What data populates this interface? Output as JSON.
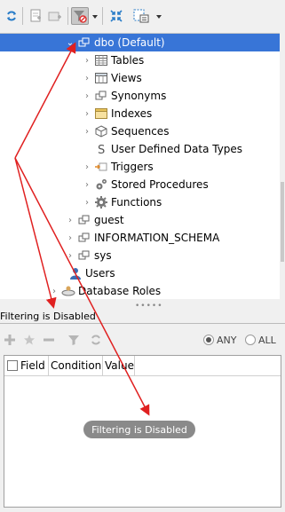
{
  "toolbar": {
    "icons": [
      "refresh-icon",
      "new-query-icon",
      "new-item-icon",
      "filter-toggle-icon",
      "collapse-icon",
      "options-icon"
    ]
  },
  "tree": {
    "items": [
      {
        "label": "dbo  (Default)",
        "icon": "schema-icon",
        "selected": true
      },
      {
        "label": "Tables",
        "icon": "table-icon"
      },
      {
        "label": "Views",
        "icon": "view-icon"
      },
      {
        "label": "Synonyms",
        "icon": "synonym-icon"
      },
      {
        "label": "Indexes",
        "icon": "index-icon"
      },
      {
        "label": "Sequences",
        "icon": "sequence-icon"
      },
      {
        "label": "User Defined Data Types",
        "icon": "datatype-icon"
      },
      {
        "label": "Triggers",
        "icon": "trigger-icon"
      },
      {
        "label": "Stored Procedures",
        "icon": "procedure-icon"
      },
      {
        "label": "Functions",
        "icon": "function-icon"
      },
      {
        "label": "guest",
        "icon": "schema-icon"
      },
      {
        "label": "INFORMATION_SCHEMA",
        "icon": "schema-icon"
      },
      {
        "label": "sys",
        "icon": "schema-icon"
      },
      {
        "label": "Users",
        "icon": "user-icon"
      },
      {
        "label": "Database Roles",
        "icon": "role-icon"
      }
    ]
  },
  "filter": {
    "title": "Filtering is Disabled",
    "any_label": "ANY",
    "all_label": "ALL",
    "columns": [
      "Field",
      "Condition",
      "Value"
    ],
    "toast": "Filtering is Disabled"
  },
  "colors": {
    "selection": "#3875d7",
    "arrow": "#e02020"
  }
}
